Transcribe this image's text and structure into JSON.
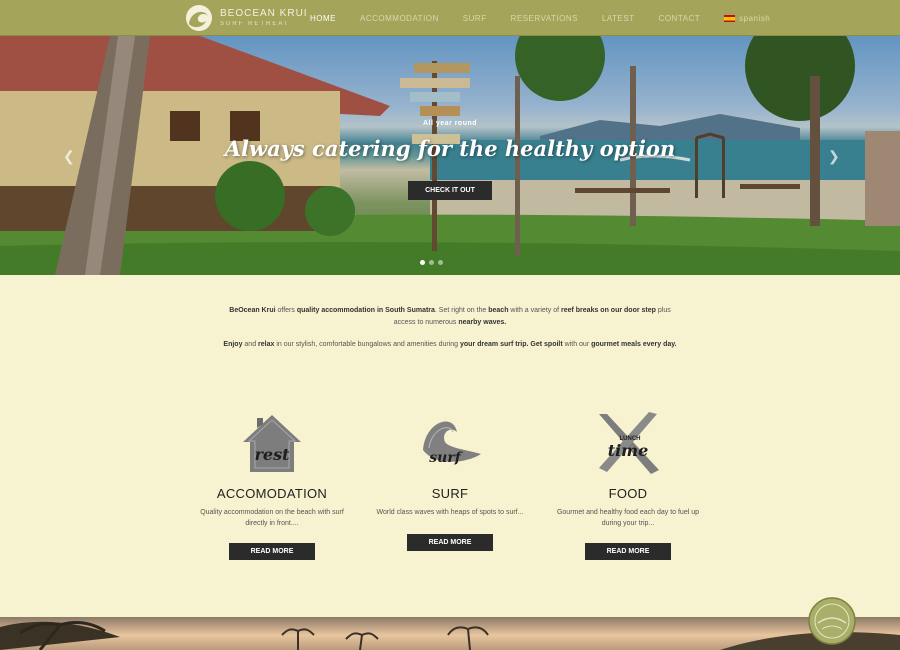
{
  "brand": {
    "name": "BEOCEAN KRUI",
    "tagline": "SURF RETREAT"
  },
  "nav": {
    "items": [
      "HOME",
      "ACCOMMODATION",
      "SURF",
      "RESERVATIONS",
      "LATEST",
      "CONTACT"
    ],
    "language": "spanish"
  },
  "hero": {
    "kicker": "All year round",
    "title": "Always catering for the healthy option",
    "button": "CHECK IT OUT"
  },
  "features": [
    {
      "icon_label": "rest",
      "title": "ACCOMODATION",
      "text": "Quality accommodation on the beach with surf directly in front....",
      "button": "READ MORE"
    },
    {
      "icon_label": "surf",
      "title": "SURF",
      "text": "World class waves with heaps of spots to surf...",
      "button": "READ MORE"
    },
    {
      "icon_label": "time",
      "icon_sublabel": "LUNCH",
      "title": "FOOD",
      "text": "Gourmet and healthy food each day to fuel up during your trip...",
      "button": "READ MORE"
    }
  ],
  "colors": {
    "navbar": "#a4a45a",
    "page_bg": "#f7f2cf",
    "button": "#2b2b2b"
  }
}
